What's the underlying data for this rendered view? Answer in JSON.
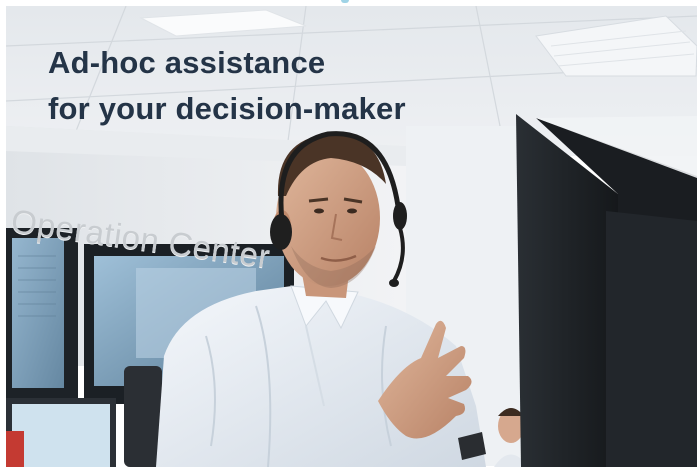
{
  "hero": {
    "headline_line1": "Ad-hoc assistance",
    "headline_line2": "for your decision-maker",
    "wall_sign": "Operation Center"
  },
  "colors": {
    "headline": "#243447",
    "shirt": "#e8eef5",
    "ceiling": "#e9ecef",
    "monitor_bezel": "#1e2226"
  }
}
